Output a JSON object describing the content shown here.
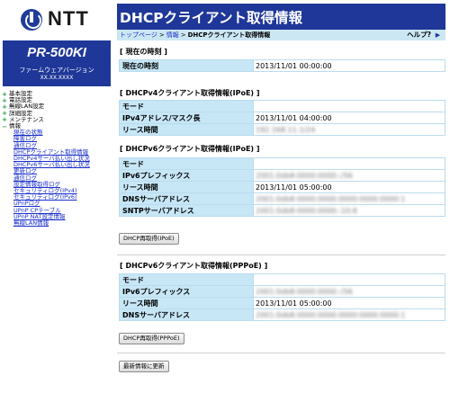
{
  "brand": {
    "logo_text": "NTT"
  },
  "device": {
    "model": "PR-500KI",
    "fw_label": "ファームウェアバージョン",
    "fw_version": "XX.XX.XXXX"
  },
  "nav": {
    "top_items": [
      {
        "label": "基本設定",
        "icon": "plus-icon"
      },
      {
        "label": "電話設定",
        "icon": "plus-icon"
      },
      {
        "label": "無線LAN設定",
        "icon": "plus-icon"
      },
      {
        "label": "詳細設定",
        "icon": "plus-icon"
      },
      {
        "label": "メンテナンス",
        "icon": "plus-icon"
      },
      {
        "label": "情報",
        "icon": "minus-icon"
      }
    ],
    "sub_items": [
      "現在の状態",
      "障害ログ",
      "通信ログ",
      "DHCPクライアント取得情報",
      "DHCPv4サーバ払い出し状況",
      "DHCPv6サーバ払い出し状況",
      "更新ログ",
      "通信ログ",
      "設定情報取得ログ",
      "セキュリティログ(IPv4)",
      "セキュリティログ(IPv6)",
      "UPnPログ",
      "UPnP CPテーブル",
      "UPnP NAT設定情報",
      "無線LAN情報"
    ]
  },
  "header": {
    "title": "DHCPクライアント取得情報"
  },
  "breadcrumb": {
    "top": "トップページ",
    "sep": ">",
    "info": "情報",
    "current": "DHCPクライアント取得情報",
    "help": "ヘルプ?"
  },
  "sections": {
    "now": {
      "title": "[ 現在の時刻 ]",
      "rows": [
        {
          "k": "現在の時刻",
          "v": "2013/11/01 00:00:00"
        }
      ]
    },
    "v4": {
      "title": "[ DHCPv4クライアント取得情報(IPoE) ]",
      "rows": [
        {
          "k": "モード",
          "v": ""
        },
        {
          "k": "IPv4アドレス/マスク長",
          "v": "2013/11/01 04:00:00"
        },
        {
          "k": "リース時間",
          "v": "192.168.11.1/24"
        }
      ]
    },
    "v6ipoe": {
      "title": "[ DHCPv6クライアント取得情報(IPoE) ]",
      "rows": [
        {
          "k": "モード",
          "v": ""
        },
        {
          "k": "IPv6プレフィックス",
          "v": "2001:0db8:0000:0000::/56"
        },
        {
          "k": "リース時間",
          "v": "2013/11/01 05:00:00"
        },
        {
          "k": "DNSサーバアドレス",
          "v": "2001:0db8:0000:0000:0000:0000:0000:1"
        },
        {
          "k": "SNTPサーバアドレス",
          "v": "2001:0db8:0000:0000::10:8"
        }
      ],
      "button": "DHCP再取得(IPoE)"
    },
    "v6pppoe": {
      "title": "[ DHCPv6クライアント取得情報(PPPoE) ]",
      "rows": [
        {
          "k": "モード",
          "v": ""
        },
        {
          "k": "IPv6プレフィックス",
          "v": "2001:0db8:0000:0000::/56"
        },
        {
          "k": "リース時間",
          "v": "2013/11/01 05:00:00"
        },
        {
          "k": "DNSサーバアドレス",
          "v": "2001:0db8:0000:0000:0000:0000:0000:1"
        }
      ],
      "button": "DHCP再取得(PPPoE)"
    }
  },
  "refresh_button": "最新情報に更新",
  "colors": {
    "brand_blue": "#1f3798",
    "key_cell": "#c7e6f6",
    "crumb_bg": "#cce7f4",
    "nav_link": "#1a2fcc"
  }
}
